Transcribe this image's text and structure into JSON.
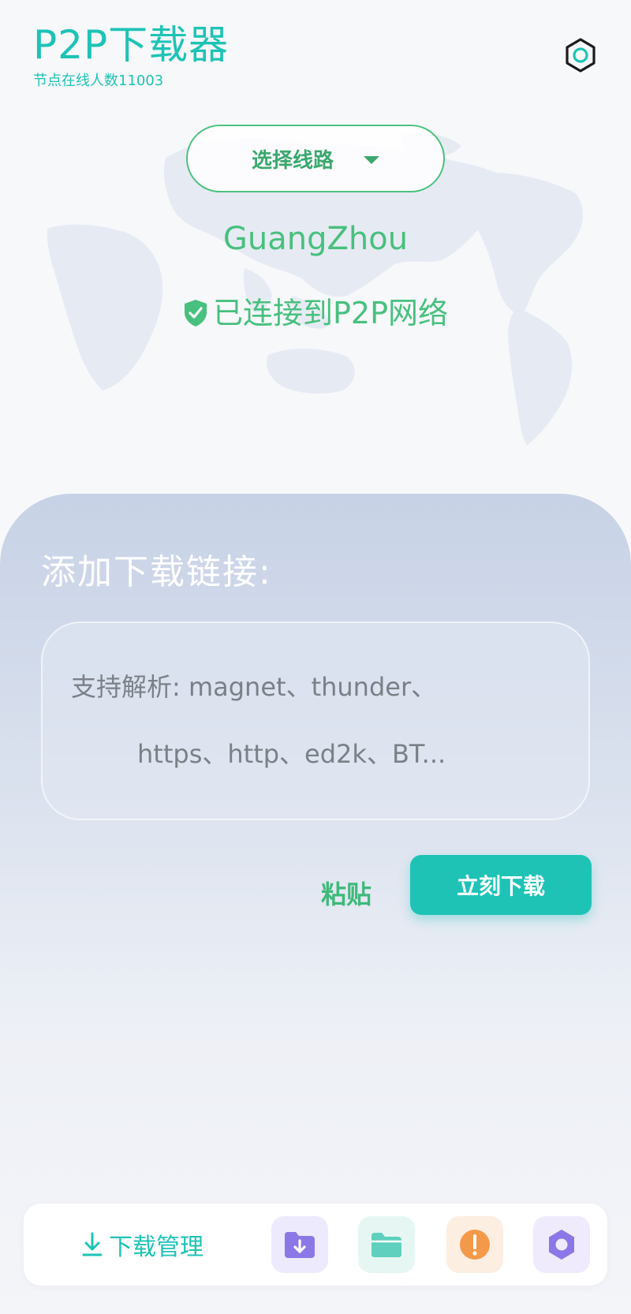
{
  "header": {
    "title": "P2P下载器",
    "online_label": "节点在线人数",
    "online_count": "11003"
  },
  "route": {
    "select_label": "选择线路",
    "city": "GuangZhou",
    "status": "已连接到P2P网络"
  },
  "panel": {
    "heading": "添加下载链接:",
    "input_placeholder_line1": "支持解析: magnet、thunder、",
    "input_placeholder_line2": "https、http、ed2k、BT...",
    "paste_label": "粘贴",
    "download_now_label": "立刻下载"
  },
  "bottom_nav": {
    "download_manager_label": "下载管理",
    "icons": [
      "folder-download-icon",
      "folder-icon",
      "alert-icon",
      "settings-hex-icon"
    ]
  },
  "colors": {
    "accent": "#1ec3b6",
    "success_green": "#48c07e",
    "panel_top": "#c7d2e6",
    "alert_orange": "#f29a4a",
    "purple": "#8b78e6"
  }
}
